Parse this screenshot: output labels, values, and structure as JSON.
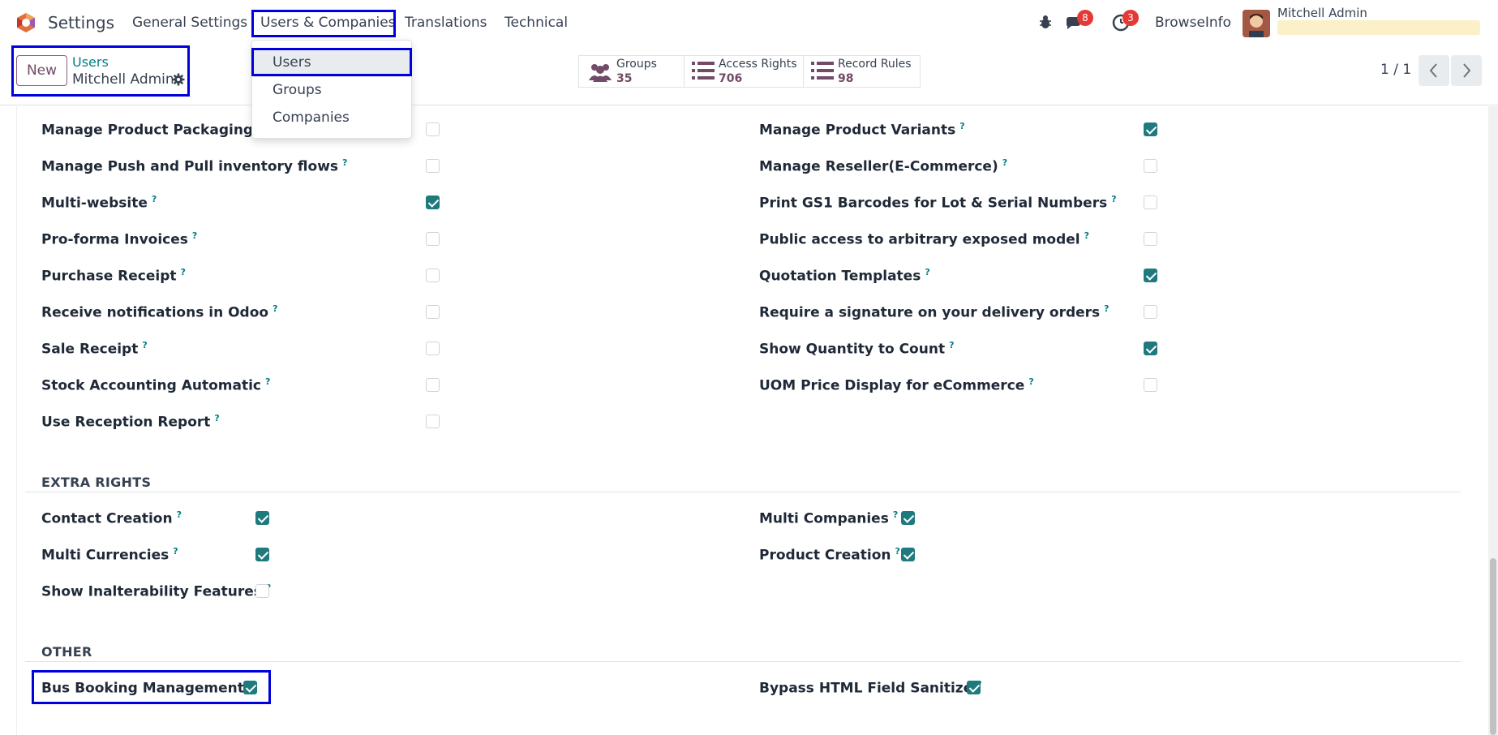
{
  "navbar": {
    "app_title": "Settings",
    "menu": [
      "General Settings",
      "Users & Companies",
      "Translations",
      "Technical"
    ],
    "messages_count": "8",
    "activities_count": "3",
    "company": "BrowseInfo",
    "user_name": "Mitchell Admin"
  },
  "dropdown": {
    "items": [
      "Users",
      "Groups",
      "Companies"
    ]
  },
  "control": {
    "new_label": "New",
    "breadcrumb_parent": "Users",
    "breadcrumb_current": "Mitchell Admin",
    "stats": [
      {
        "label": "Groups",
        "count": "35"
      },
      {
        "label": "Access Rights",
        "count": "706"
      },
      {
        "label": "Record Rules",
        "count": "98"
      }
    ],
    "pager": "1 / 1"
  },
  "fields": {
    "left": [
      {
        "label": "Manage Product Packaging",
        "checked": false
      },
      {
        "label": "Manage Push and Pull inventory flows",
        "checked": false
      },
      {
        "label": "Multi-website",
        "checked": true
      },
      {
        "label": "Pro-forma Invoices",
        "checked": false
      },
      {
        "label": "Purchase Receipt",
        "checked": false
      },
      {
        "label": "Receive notifications in Odoo",
        "checked": false
      },
      {
        "label": "Sale Receipt",
        "checked": false
      },
      {
        "label": "Stock Accounting Automatic",
        "checked": false
      },
      {
        "label": "Use Reception Report",
        "checked": false
      }
    ],
    "right": [
      {
        "label": "Manage Product Variants",
        "checked": true
      },
      {
        "label": "Manage Reseller(E-Commerce)",
        "checked": false
      },
      {
        "label": "Print GS1 Barcodes for Lot & Serial Numbers",
        "checked": false
      },
      {
        "label": "Public access to arbitrary exposed model",
        "checked": false
      },
      {
        "label": "Quotation Templates",
        "checked": true
      },
      {
        "label": "Require a signature on your delivery orders",
        "checked": false
      },
      {
        "label": "Show Quantity to Count",
        "checked": true
      },
      {
        "label": "UOM Price Display for eCommerce",
        "checked": false
      }
    ]
  },
  "extra_rights": {
    "title": "EXTRA RIGHTS",
    "left": [
      {
        "label": "Contact Creation",
        "checked": true
      },
      {
        "label": "Multi Currencies",
        "checked": true
      },
      {
        "label": "Show Inalterability Features",
        "checked": false
      }
    ],
    "right": [
      {
        "label": "Multi Companies",
        "checked": true
      },
      {
        "label": "Product Creation",
        "checked": true
      }
    ]
  },
  "other": {
    "title": "OTHER",
    "left": [
      {
        "label": "Bus Booking Management",
        "checked": true
      }
    ],
    "right": [
      {
        "label": "Bypass HTML Field Sanitize",
        "checked": true
      }
    ]
  },
  "help_mark": "?",
  "colors": {
    "accent": "#714b67",
    "teal": "#017e84",
    "checkbox": "#1f7a7e",
    "highlight": "#0000dd"
  }
}
